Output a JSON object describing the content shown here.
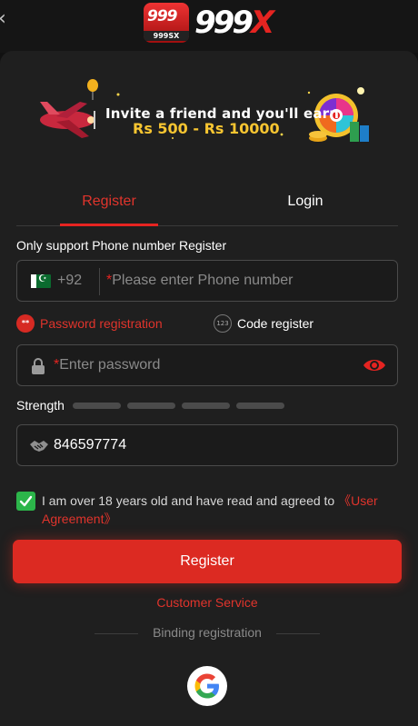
{
  "header": {
    "logo_badge_number": "999",
    "logo_badge_sub": "999SX",
    "logo_word_main": "999",
    "logo_word_accent": "X"
  },
  "banner": {
    "line1": "Invite a friend and you'll earn",
    "line2": "Rs 500 - Rs 10000"
  },
  "tabs": [
    {
      "label": "Register",
      "active": true
    },
    {
      "label": "Login",
      "active": false
    }
  ],
  "form": {
    "notice": "Only support Phone number Register",
    "phone": {
      "country_code": "+92",
      "required_mark": "*",
      "placeholder": "Please enter Phone number"
    },
    "methods": {
      "password": {
        "icon_text": "**",
        "label": "Password registration",
        "active": true
      },
      "code": {
        "icon_text": "123",
        "label": "Code register",
        "active": false
      }
    },
    "password": {
      "required_mark": "*",
      "placeholder": "Enter password"
    },
    "strength": {
      "label": "Strength",
      "level": 0,
      "segments": 4
    },
    "invite_code": {
      "value": "846597774"
    },
    "agreement": {
      "checked": true,
      "text": "I am over 18 years old and have read and agreed to ",
      "link": "《User Agreement》"
    },
    "submit_label": "Register"
  },
  "footer": {
    "customer_service": "Customer Service",
    "binding_label": "Binding registration",
    "social": [
      {
        "name": "google-icon"
      }
    ]
  },
  "colors": {
    "accent": "#e52421",
    "background": "#1f1f1f",
    "check_green": "#2cb54a",
    "gold": "#f7c531"
  }
}
